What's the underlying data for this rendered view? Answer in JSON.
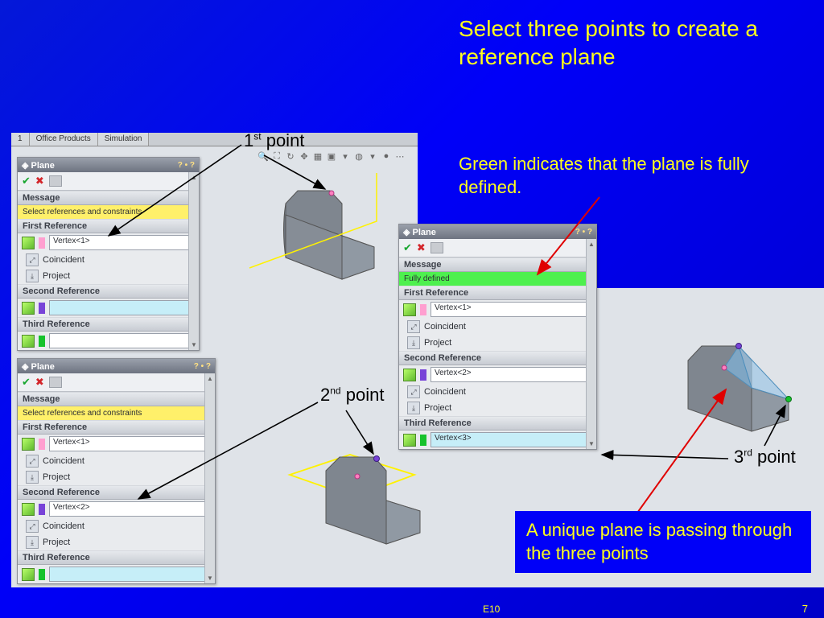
{
  "title": "Select three points to create a reference plane",
  "note_green": "Green indicates that the plane is fully defined.",
  "note_plane": "A unique plane is passing through the three points",
  "page_num": "7",
  "footer_code": "E10",
  "point_labels": {
    "p1": "1",
    "p1s": "st",
    "p1t": " point",
    "p2": "2",
    "p2s": "nd",
    "p2t": " point",
    "p3": "3",
    "p3s": "rd",
    "p3t": " point"
  },
  "tabs": {
    "a": "1",
    "b": "Office Products",
    "c": "Simulation"
  },
  "panel": {
    "title": "Plane",
    "help": "? • ?",
    "msg_label": "Message",
    "msg_select": "Select references and constraints",
    "msg_full": "Fully defined",
    "first": "First Reference",
    "second": "Second Reference",
    "third": "Third Reference",
    "coincident": "Coincident",
    "project": "Project",
    "v1": "Vertex<1>",
    "v2": "Vertex<2>",
    "v3": "Vertex<3>"
  }
}
